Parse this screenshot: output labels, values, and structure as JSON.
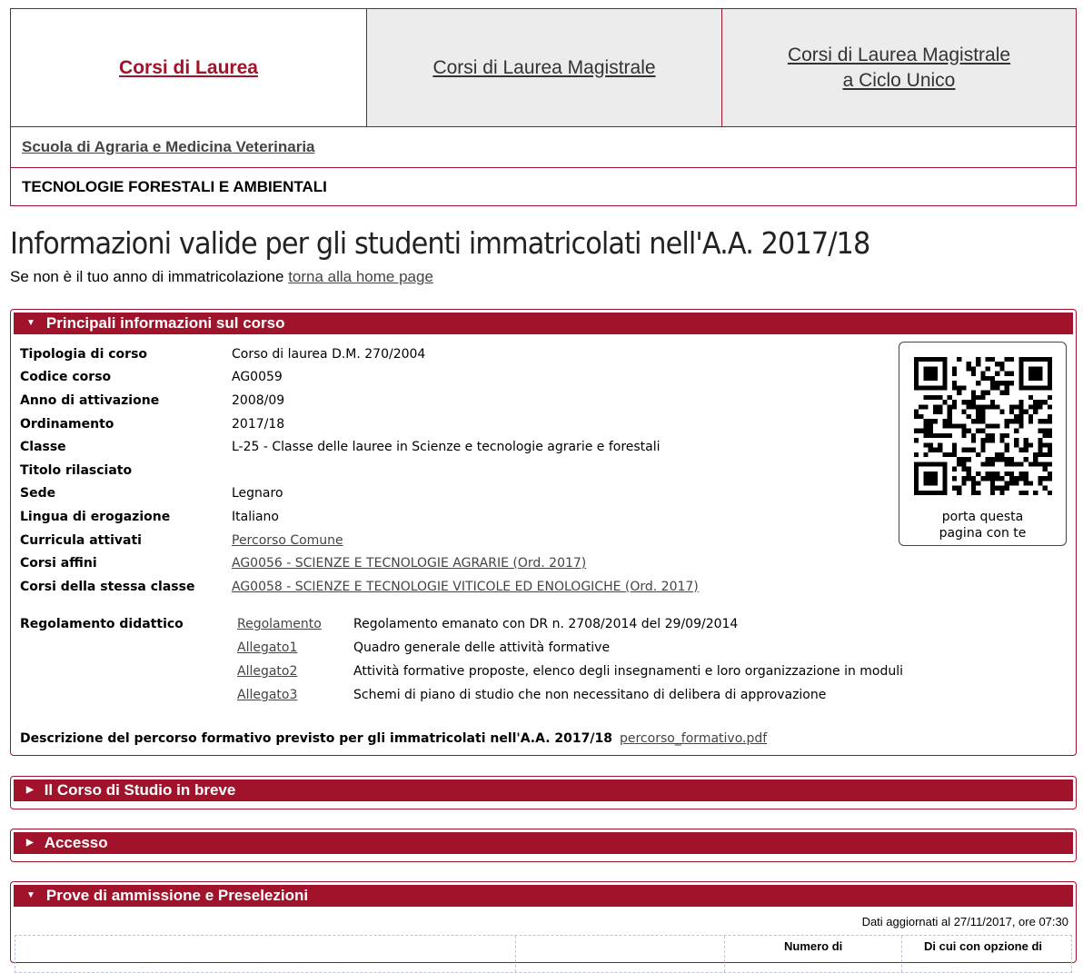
{
  "nav": {
    "tab1": "Corsi di Laurea",
    "tab2": "Corsi di Laurea Magistrale",
    "tab3_line1": "Corsi di Laurea Magistrale",
    "tab3_line2": "a Ciclo Unico"
  },
  "school": "Scuola di Agraria e Medicina Veterinaria",
  "course_name": "TECNOLOGIE FORESTALI E AMBIENTALI",
  "page_title": "Informazioni valide per gli studenti immatricolati nell'A.A. 2017/18",
  "subtitle": {
    "text": "Se non è il tuo anno di immatricolazione ",
    "link": "torna alla home page"
  },
  "sections": {
    "main": "Principali informazioni sul corso",
    "breve": "Il Corso di Studio in breve",
    "accesso": "Accesso",
    "prove": "Prove di ammissione e Preselezioni"
  },
  "info": [
    {
      "label": "Tipologia di corso",
      "value": "Corso di laurea D.M. 270/2004"
    },
    {
      "label": "Codice corso",
      "value": "AG0059"
    },
    {
      "label": "Anno di attivazione",
      "value": "2008/09"
    },
    {
      "label": "Ordinamento",
      "value": "2017/18"
    },
    {
      "label": "Classe",
      "value": "L-25 - Classe delle lauree in Scienze e tecnologie agrarie e forestali"
    },
    {
      "label": "Titolo rilasciato",
      "value": ""
    },
    {
      "label": "Sede",
      "value": "Legnaro"
    },
    {
      "label": "Lingua di erogazione",
      "value": "Italiano"
    },
    {
      "label": "Curricula attivati",
      "value": "Percorso Comune"
    },
    {
      "label": "Corsi affini",
      "value": "AG0056 - SCIENZE E TECNOLOGIE AGRARIE (Ord. 2017)"
    },
    {
      "label": "Corsi della stessa classe",
      "value": "AG0058 - SCIENZE E TECNOLOGIE VITICOLE ED ENOLOGICHE (Ord. 2017)"
    }
  ],
  "regolamento": {
    "label": "Regolamento didattico",
    "rows": [
      {
        "doc": "Regolamento",
        "text": "Regolamento emanato con DR n. 2708/2014 del 29/09/2014"
      },
      {
        "doc": "Allegato1",
        "text": "Quadro generale delle attività formative"
      },
      {
        "doc": "Allegato2",
        "text": "Attività formative proposte, elenco degli insegnamenti e loro organizzazione in moduli"
      },
      {
        "doc": "Allegato3",
        "text": "Schemi di piano di studio che non necessitano di delibera di approvazione"
      }
    ]
  },
  "descrizione": {
    "label": "Descrizione del percorso formativo previsto per gli immatricolati nell'A.A. 2017/18",
    "link": "percorso_formativo.pdf"
  },
  "qr": {
    "caption_line1": "porta questa",
    "caption_line2": "pagina con te",
    "icon": "qr-code"
  },
  "prove": {
    "updated": "Dati aggiornati al 27/11/2017, ore 07:30",
    "col3": "Numero di",
    "col4": "Di cui con opzione di"
  },
  "colors": {
    "accent": "#a0132a",
    "tab_bg": "#ececec"
  }
}
